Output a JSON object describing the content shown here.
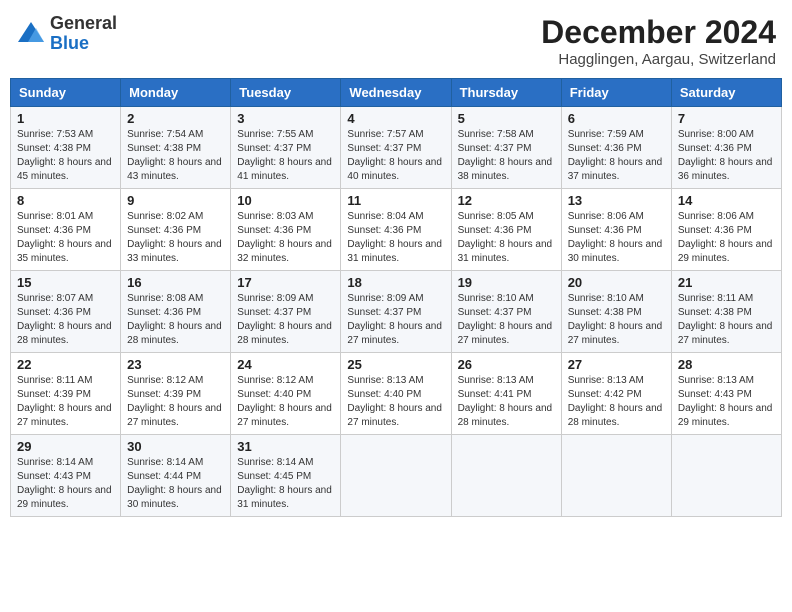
{
  "header": {
    "logo_general": "General",
    "logo_blue": "Blue",
    "month_title": "December 2024",
    "location": "Hagglingen, Aargau, Switzerland"
  },
  "weekdays": [
    "Sunday",
    "Monday",
    "Tuesday",
    "Wednesday",
    "Thursday",
    "Friday",
    "Saturday"
  ],
  "weeks": [
    [
      {
        "day": "1",
        "sunrise": "Sunrise: 7:53 AM",
        "sunset": "Sunset: 4:38 PM",
        "daylight": "Daylight: 8 hours and 45 minutes."
      },
      {
        "day": "2",
        "sunrise": "Sunrise: 7:54 AM",
        "sunset": "Sunset: 4:38 PM",
        "daylight": "Daylight: 8 hours and 43 minutes."
      },
      {
        "day": "3",
        "sunrise": "Sunrise: 7:55 AM",
        "sunset": "Sunset: 4:37 PM",
        "daylight": "Daylight: 8 hours and 41 minutes."
      },
      {
        "day": "4",
        "sunrise": "Sunrise: 7:57 AM",
        "sunset": "Sunset: 4:37 PM",
        "daylight": "Daylight: 8 hours and 40 minutes."
      },
      {
        "day": "5",
        "sunrise": "Sunrise: 7:58 AM",
        "sunset": "Sunset: 4:37 PM",
        "daylight": "Daylight: 8 hours and 38 minutes."
      },
      {
        "day": "6",
        "sunrise": "Sunrise: 7:59 AM",
        "sunset": "Sunset: 4:36 PM",
        "daylight": "Daylight: 8 hours and 37 minutes."
      },
      {
        "day": "7",
        "sunrise": "Sunrise: 8:00 AM",
        "sunset": "Sunset: 4:36 PM",
        "daylight": "Daylight: 8 hours and 36 minutes."
      }
    ],
    [
      {
        "day": "8",
        "sunrise": "Sunrise: 8:01 AM",
        "sunset": "Sunset: 4:36 PM",
        "daylight": "Daylight: 8 hours and 35 minutes."
      },
      {
        "day": "9",
        "sunrise": "Sunrise: 8:02 AM",
        "sunset": "Sunset: 4:36 PM",
        "daylight": "Daylight: 8 hours and 33 minutes."
      },
      {
        "day": "10",
        "sunrise": "Sunrise: 8:03 AM",
        "sunset": "Sunset: 4:36 PM",
        "daylight": "Daylight: 8 hours and 32 minutes."
      },
      {
        "day": "11",
        "sunrise": "Sunrise: 8:04 AM",
        "sunset": "Sunset: 4:36 PM",
        "daylight": "Daylight: 8 hours and 31 minutes."
      },
      {
        "day": "12",
        "sunrise": "Sunrise: 8:05 AM",
        "sunset": "Sunset: 4:36 PM",
        "daylight": "Daylight: 8 hours and 31 minutes."
      },
      {
        "day": "13",
        "sunrise": "Sunrise: 8:06 AM",
        "sunset": "Sunset: 4:36 PM",
        "daylight": "Daylight: 8 hours and 30 minutes."
      },
      {
        "day": "14",
        "sunrise": "Sunrise: 8:06 AM",
        "sunset": "Sunset: 4:36 PM",
        "daylight": "Daylight: 8 hours and 29 minutes."
      }
    ],
    [
      {
        "day": "15",
        "sunrise": "Sunrise: 8:07 AM",
        "sunset": "Sunset: 4:36 PM",
        "daylight": "Daylight: 8 hours and 28 minutes."
      },
      {
        "day": "16",
        "sunrise": "Sunrise: 8:08 AM",
        "sunset": "Sunset: 4:36 PM",
        "daylight": "Daylight: 8 hours and 28 minutes."
      },
      {
        "day": "17",
        "sunrise": "Sunrise: 8:09 AM",
        "sunset": "Sunset: 4:37 PM",
        "daylight": "Daylight: 8 hours and 28 minutes."
      },
      {
        "day": "18",
        "sunrise": "Sunrise: 8:09 AM",
        "sunset": "Sunset: 4:37 PM",
        "daylight": "Daylight: 8 hours and 27 minutes."
      },
      {
        "day": "19",
        "sunrise": "Sunrise: 8:10 AM",
        "sunset": "Sunset: 4:37 PM",
        "daylight": "Daylight: 8 hours and 27 minutes."
      },
      {
        "day": "20",
        "sunrise": "Sunrise: 8:10 AM",
        "sunset": "Sunset: 4:38 PM",
        "daylight": "Daylight: 8 hours and 27 minutes."
      },
      {
        "day": "21",
        "sunrise": "Sunrise: 8:11 AM",
        "sunset": "Sunset: 4:38 PM",
        "daylight": "Daylight: 8 hours and 27 minutes."
      }
    ],
    [
      {
        "day": "22",
        "sunrise": "Sunrise: 8:11 AM",
        "sunset": "Sunset: 4:39 PM",
        "daylight": "Daylight: 8 hours and 27 minutes."
      },
      {
        "day": "23",
        "sunrise": "Sunrise: 8:12 AM",
        "sunset": "Sunset: 4:39 PM",
        "daylight": "Daylight: 8 hours and 27 minutes."
      },
      {
        "day": "24",
        "sunrise": "Sunrise: 8:12 AM",
        "sunset": "Sunset: 4:40 PM",
        "daylight": "Daylight: 8 hours and 27 minutes."
      },
      {
        "day": "25",
        "sunrise": "Sunrise: 8:13 AM",
        "sunset": "Sunset: 4:40 PM",
        "daylight": "Daylight: 8 hours and 27 minutes."
      },
      {
        "day": "26",
        "sunrise": "Sunrise: 8:13 AM",
        "sunset": "Sunset: 4:41 PM",
        "daylight": "Daylight: 8 hours and 28 minutes."
      },
      {
        "day": "27",
        "sunrise": "Sunrise: 8:13 AM",
        "sunset": "Sunset: 4:42 PM",
        "daylight": "Daylight: 8 hours and 28 minutes."
      },
      {
        "day": "28",
        "sunrise": "Sunrise: 8:13 AM",
        "sunset": "Sunset: 4:43 PM",
        "daylight": "Daylight: 8 hours and 29 minutes."
      }
    ],
    [
      {
        "day": "29",
        "sunrise": "Sunrise: 8:14 AM",
        "sunset": "Sunset: 4:43 PM",
        "daylight": "Daylight: 8 hours and 29 minutes."
      },
      {
        "day": "30",
        "sunrise": "Sunrise: 8:14 AM",
        "sunset": "Sunset: 4:44 PM",
        "daylight": "Daylight: 8 hours and 30 minutes."
      },
      {
        "day": "31",
        "sunrise": "Sunrise: 8:14 AM",
        "sunset": "Sunset: 4:45 PM",
        "daylight": "Daylight: 8 hours and 31 minutes."
      },
      null,
      null,
      null,
      null
    ]
  ]
}
